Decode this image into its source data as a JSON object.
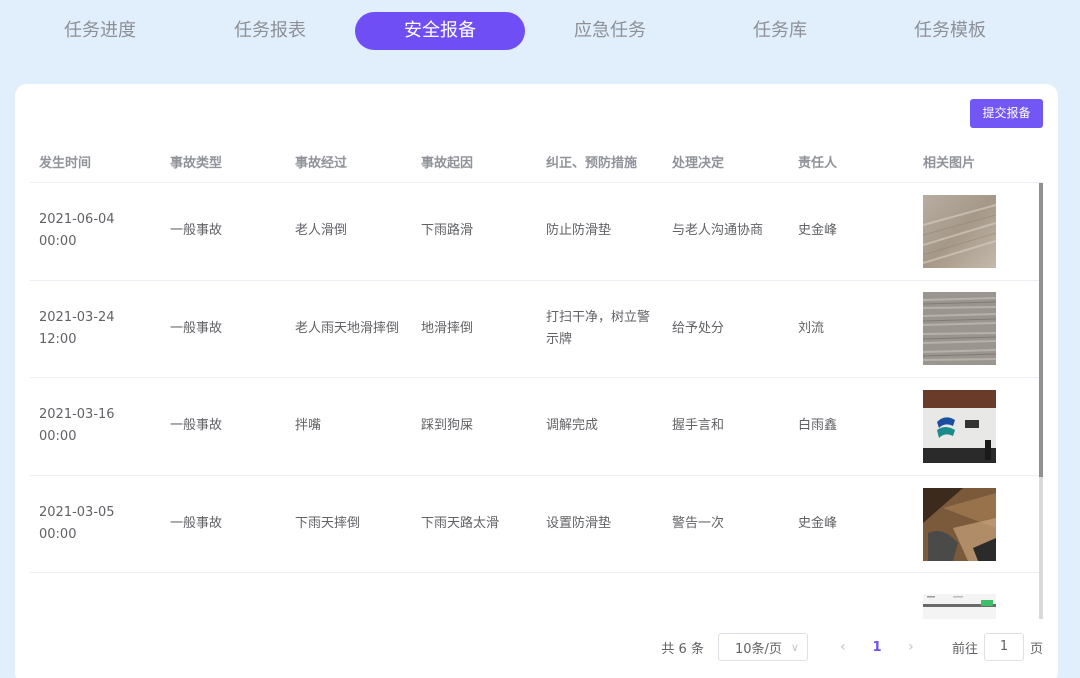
{
  "tabs": [
    {
      "label": "任务进度",
      "active": false
    },
    {
      "label": "任务报表",
      "active": false
    },
    {
      "label": "安全报备",
      "active": true
    },
    {
      "label": "应急任务",
      "active": false
    },
    {
      "label": "任务库",
      "active": false
    },
    {
      "label": "任务模板",
      "active": false
    }
  ],
  "toolbar": {
    "submit_label": "提交报备"
  },
  "table": {
    "columns": [
      "发生时间",
      "事故类型",
      "事故经过",
      "事故起因",
      "纠正、预防措施",
      "处理决定",
      "责任人",
      "相关图片"
    ],
    "rows": [
      {
        "time": "2021-06-04 00:00",
        "type": "一般事故",
        "process": "老人滑倒",
        "cause": "下雨路滑",
        "measures": "防止防滑垫",
        "decision": "与老人沟通协商",
        "person": "史金峰",
        "image": "wood-floor-photo"
      },
      {
        "time": "2021-03-24 12:00",
        "type": "一般事故",
        "process": "老人雨天地滑摔倒",
        "cause": "地滑摔倒",
        "measures": "打扫干净，树立警示牌",
        "decision": "给予处分",
        "person": "刘流",
        "image": "grey-wood-photo"
      },
      {
        "time": "2021-03-16 00:00",
        "type": "一般事故",
        "process": "拌嘴",
        "cause": "踩到狗屎",
        "measures": "调解完成",
        "decision": "握手言和",
        "person": "白雨鑫",
        "image": "logo-sign-photo"
      },
      {
        "time": "2021-03-05 00:00",
        "type": "一般事故",
        "process": "下雨天摔倒",
        "cause": "下雨天路太滑",
        "measures": "设置防滑垫",
        "decision": "警告一次",
        "person": "史金峰",
        "image": "floor-shoe-photo"
      }
    ]
  },
  "pagination": {
    "total": "共 6 条",
    "page_size": "10条/页",
    "prev": "‹",
    "current": "1",
    "next": "›",
    "goto_label": "前往",
    "goto_value": "1",
    "goto_suffix": "页"
  },
  "colors": {
    "accent": "#6f4ff5",
    "background": "#e1effd"
  }
}
